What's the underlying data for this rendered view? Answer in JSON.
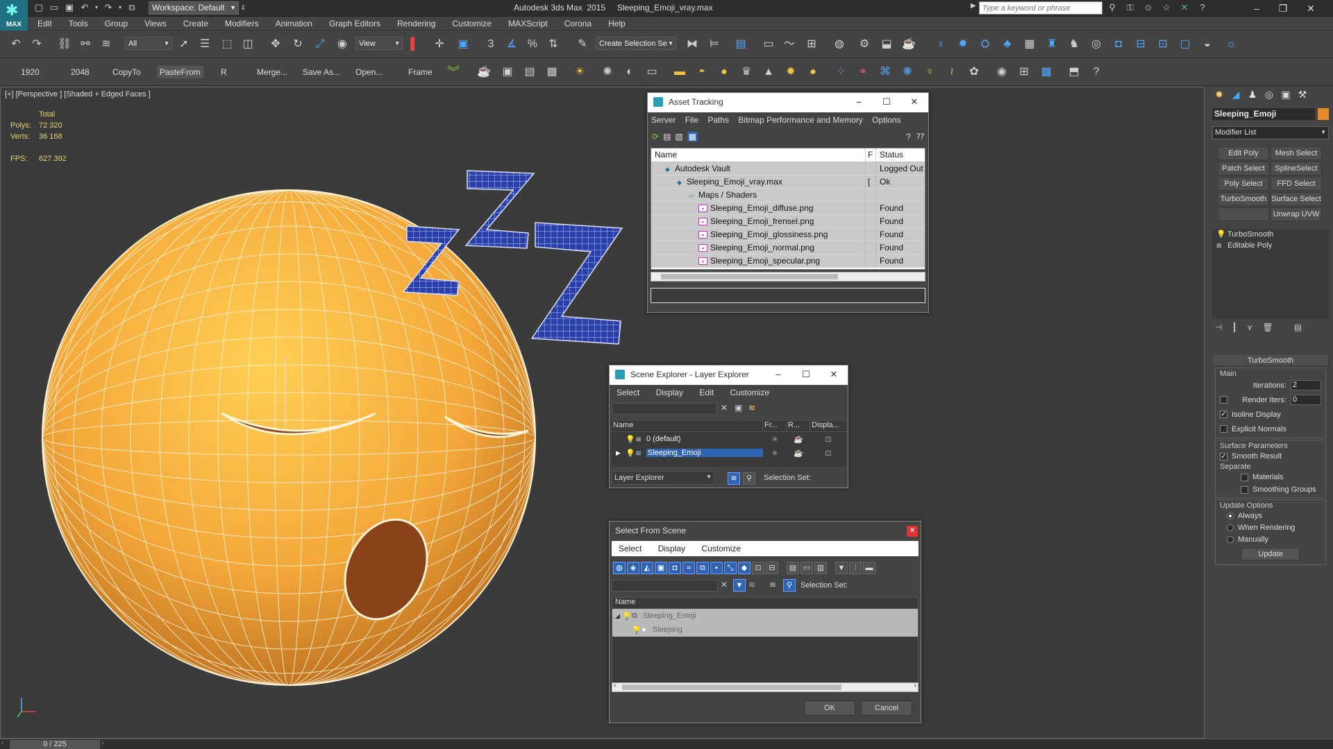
{
  "app": {
    "logo_text": "MAX",
    "title": "Autodesk 3ds Max  2015     Sleeping_Emoji_vray.max",
    "workspace": "Workspace: Default",
    "search_placeholder": "Type a keyword or phrase"
  },
  "menu": [
    "Edit",
    "Tools",
    "Group",
    "Views",
    "Create",
    "Modifiers",
    "Animation",
    "Graph Editors",
    "Rendering",
    "Customize",
    "MAXScript",
    "Corona",
    "Help"
  ],
  "toolbar": {
    "selection_filter": "All",
    "ref_coord": "View",
    "named_selection": "Create Selection Se"
  },
  "toolbar2": {
    "buttons": [
      "1920",
      "2048",
      "CopyTo",
      "PasteFrom",
      "R",
      "Merge...",
      "Save As...",
      "Open...",
      "Frame"
    ]
  },
  "viewport": {
    "label": "[+] [Perspective ] [Shaded + Edged Faces ]",
    "stats": {
      "total_label": "Total",
      "polys_label": "Polys:",
      "polys": "72 320",
      "verts_label": "Verts:",
      "verts": "36 168",
      "fps_label": "FPS:",
      "fps": "627.392"
    },
    "gizmo_label": "z"
  },
  "statusbar": {
    "time": "0 / 225"
  },
  "command_panel": {
    "object_name": "Sleeping_Emoji",
    "object_color": "#e68a2e",
    "modifier_list": "Modifier List",
    "mod_buttons": [
      "Edit Poly",
      "Mesh Select",
      "Patch Select",
      "SplineSelect",
      "Poly Select",
      "FFD Select",
      "TurboSmooth",
      "Surface Select",
      "",
      "Unwrap UVW"
    ],
    "stack": [
      "TurboSmooth",
      "Editable Poly"
    ],
    "rollout": {
      "title": "TurboSmooth",
      "main_label": "Main",
      "iterations_label": "Iterations:",
      "iterations": "2",
      "render_iters_label": "Render Iters:",
      "render_iters": "0",
      "isoline": "Isoline Display",
      "explicit_normals": "Explicit Normals",
      "surface_params": "Surface Parameters",
      "smooth_result": "Smooth Result",
      "separate": "Separate",
      "materials": "Materials",
      "smoothing_groups": "Smoothing Groups",
      "update_options": "Update Options",
      "always": "Always",
      "when_rendering": "When Rendering",
      "manually": "Manually",
      "update_btn": "Update"
    }
  },
  "asset_tracking": {
    "title": "Asset Tracking",
    "menu": [
      "Server",
      "File",
      "Paths",
      "Bitmap Performance and Memory",
      "Options"
    ],
    "columns": [
      "Name",
      "F",
      "Status"
    ],
    "rows": [
      {
        "name": "Autodesk Vault",
        "f": "",
        "status": "Logged Out",
        "indent": 1
      },
      {
        "name": "Sleeping_Emoji_vray.max",
        "f": "[",
        "status": "Ok",
        "indent": 2
      },
      {
        "name": "Maps / Shaders",
        "f": "",
        "status": "",
        "indent": 3
      },
      {
        "name": "Sleeping_Emoji_diffuse.png",
        "f": "",
        "status": "Found",
        "indent": 4
      },
      {
        "name": "Sleeping_Emoji_frensel.png",
        "f": "",
        "status": "Found",
        "indent": 4
      },
      {
        "name": "Sleeping_Emoji_glossiness.png",
        "f": "",
        "status": "Found",
        "indent": 4
      },
      {
        "name": "Sleeping_Emoji_normal.png",
        "f": "",
        "status": "Found",
        "indent": 4
      },
      {
        "name": "Sleeping_Emoji_specular.png",
        "f": "",
        "status": "Found",
        "indent": 4
      }
    ]
  },
  "layer_explorer": {
    "title": "Scene Explorer - Layer Explorer",
    "menu": [
      "Select",
      "Display",
      "Edit",
      "Customize"
    ],
    "columns": [
      "Name",
      "Fr...",
      "R...",
      "Displa..."
    ],
    "rows": [
      {
        "name": "0 (default)",
        "selected": false
      },
      {
        "name": "Sleeping_Emoji",
        "selected": true
      }
    ],
    "footer_combo": "Layer Explorer",
    "selection_set": "Selection Set:"
  },
  "select_from_scene": {
    "title": "Select From Scene",
    "menu": [
      "Select",
      "Display",
      "Customize"
    ],
    "selection_set": "Selection Set:",
    "column": "Name",
    "rows": [
      {
        "name": "Sleeping_Emoji",
        "indent": 0
      },
      {
        "name": "Sleeping",
        "indent": 1
      }
    ],
    "ok": "OK",
    "cancel": "Cancel"
  }
}
